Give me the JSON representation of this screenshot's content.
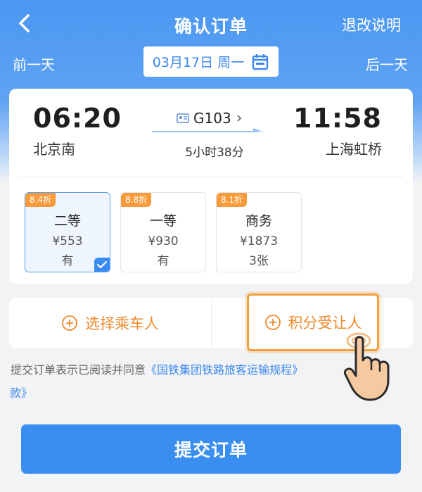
{
  "header": {
    "title": "确认订单",
    "refund_link": "退改说明",
    "prev_day": "前一天",
    "next_day": "后一天",
    "date": "03月17日 周一"
  },
  "trip": {
    "dep_time": "06:20",
    "dep_station": "北京南",
    "arr_time": "11:58",
    "arr_station": "上海虹桥",
    "train_no": "G103",
    "duration": "5小时38分"
  },
  "seats": [
    {
      "discount": "8.4折",
      "class": "二等",
      "price": "¥553",
      "availability": "有",
      "selected": true
    },
    {
      "discount": "8.8折",
      "class": "一等",
      "price": "¥930",
      "availability": "有",
      "selected": false
    },
    {
      "discount": "8.1折",
      "class": "商务",
      "price": "¥1873",
      "availability": "3张",
      "selected": false
    }
  ],
  "passenger": {
    "add_label": "选择乘车人",
    "points_label": "积分受让人"
  },
  "agreement": {
    "prefix": "提交订单表示已阅读并同意",
    "link": "《国铁集团铁路旅客运输规程》",
    "tail": "款》"
  },
  "submit_label": "提交订单",
  "colors": {
    "primary": "#3a8ef0",
    "accent_orange": "#f08a2c",
    "discount_badge": "#f79b3b"
  }
}
